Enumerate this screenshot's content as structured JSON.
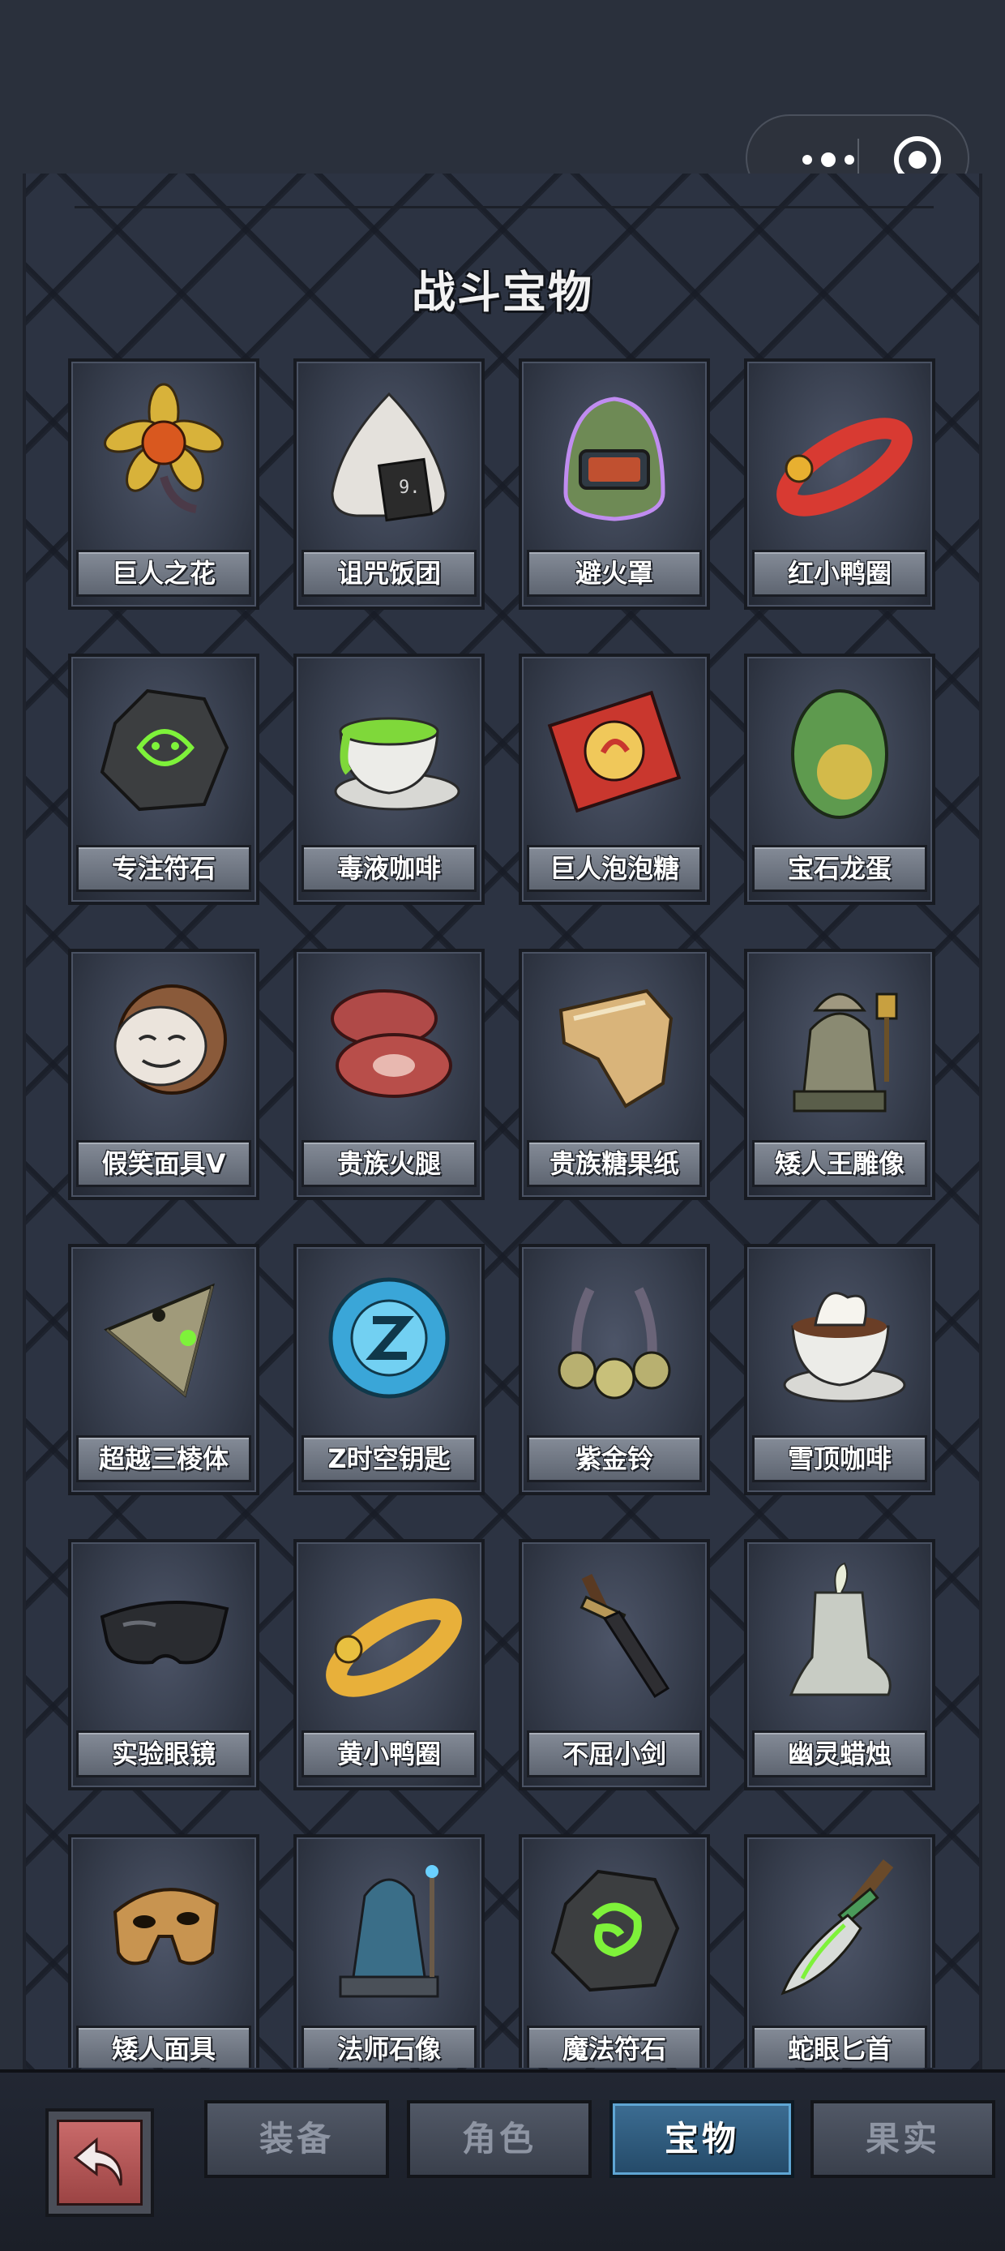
{
  "header": {
    "more_icon": "more-dots-icon",
    "close_icon": "target-circle-icon"
  },
  "title": "战斗宝物",
  "items": [
    {
      "name": "巨人之花",
      "icon": "giant-flower-icon"
    },
    {
      "name": "诅咒饭团",
      "icon": "cursed-rice-ball-icon"
    },
    {
      "name": "避火罩",
      "icon": "fire-mask-helmet-icon"
    },
    {
      "name": "红小鸭圈",
      "icon": "red-duck-ring-icon"
    },
    {
      "name": "专注符石",
      "icon": "focus-rune-stone-icon"
    },
    {
      "name": "毒液咖啡",
      "icon": "venom-coffee-icon"
    },
    {
      "name": "巨人泡泡糖",
      "icon": "giant-bubblegum-icon"
    },
    {
      "name": "宝石龙蛋",
      "icon": "gem-dragon-egg-icon"
    },
    {
      "name": "假笑面具V",
      "icon": "fake-smile-mask-icon"
    },
    {
      "name": "贵族火腿",
      "icon": "noble-ham-icon"
    },
    {
      "name": "贵族糖果纸",
      "icon": "noble-candy-wrapper-icon"
    },
    {
      "name": "矮人王雕像",
      "icon": "dwarf-king-statue-icon"
    },
    {
      "name": "超越三棱体",
      "icon": "transcend-prism-icon"
    },
    {
      "name": "Z时空钥匙",
      "icon": "z-spacetime-key-icon"
    },
    {
      "name": "紫金铃",
      "icon": "purple-gold-bell-icon"
    },
    {
      "name": "雪顶咖啡",
      "icon": "snowtop-coffee-icon"
    },
    {
      "name": "实验眼镜",
      "icon": "lab-goggles-icon"
    },
    {
      "name": "黄小鸭圈",
      "icon": "yellow-duck-ring-icon"
    },
    {
      "name": "不屈小剑",
      "icon": "unyielding-sword-icon"
    },
    {
      "name": "幽灵蜡烛",
      "icon": "ghost-candle-icon"
    },
    {
      "name": "矮人面具",
      "icon": "dwarf-mask-icon"
    },
    {
      "name": "法师石像",
      "icon": "mage-statue-icon"
    },
    {
      "name": "魔法符石",
      "icon": "magic-rune-stone-icon"
    },
    {
      "name": "蛇眼匕首",
      "icon": "snake-eye-dagger-icon"
    }
  ],
  "tabs": [
    {
      "label": "装备",
      "active": false
    },
    {
      "label": "角色",
      "active": false
    },
    {
      "label": "宝物",
      "active": true
    },
    {
      "label": "果实",
      "active": false
    }
  ],
  "back_icon": "back-arrow-icon"
}
